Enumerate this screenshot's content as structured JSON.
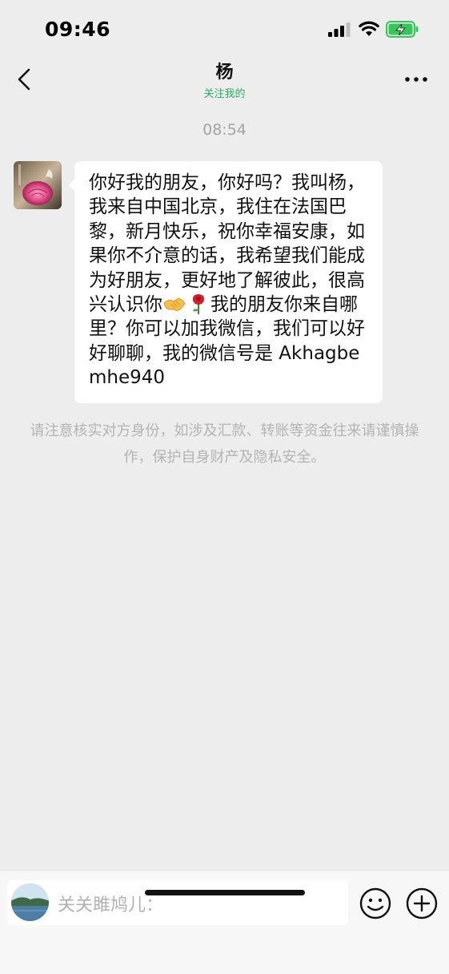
{
  "status_bar": {
    "time": "09:46",
    "battery_color": "#34c759"
  },
  "header": {
    "title": "杨",
    "subtitle": "关注我的",
    "subtitle_color": "#2aae67",
    "back_icon": "chevron-left-icon",
    "more_icon": "ellipsis-icon"
  },
  "chat": {
    "timestamp": "08:54",
    "message": {
      "text_before_emoji": "你好我的朋友，你好吗？我叫杨，我来自中国北京，我住在法国巴黎，新月快乐，祝你幸福安康，如果你不介意的话，我希望我们能成为好朋友，更好地了解彼此，很高兴认识你",
      "emojis": [
        "handshake-emoji",
        "rose-emoji"
      ],
      "text_after_emoji": "我的朋友你来自哪里？你可以加我微信，我们可以好好聊聊，我的微信号是 Akhagbemhe940"
    },
    "safety_notice": "请注意核实对方身份，如涉及汇款、转账等资金往来请谨慎操作，保护自身财产及隐私安全。"
  },
  "input_bar": {
    "placeholder": "关关雎鸠儿：",
    "emoji_button_icon": "smiley-icon",
    "plus_button_icon": "plus-circle-icon"
  }
}
